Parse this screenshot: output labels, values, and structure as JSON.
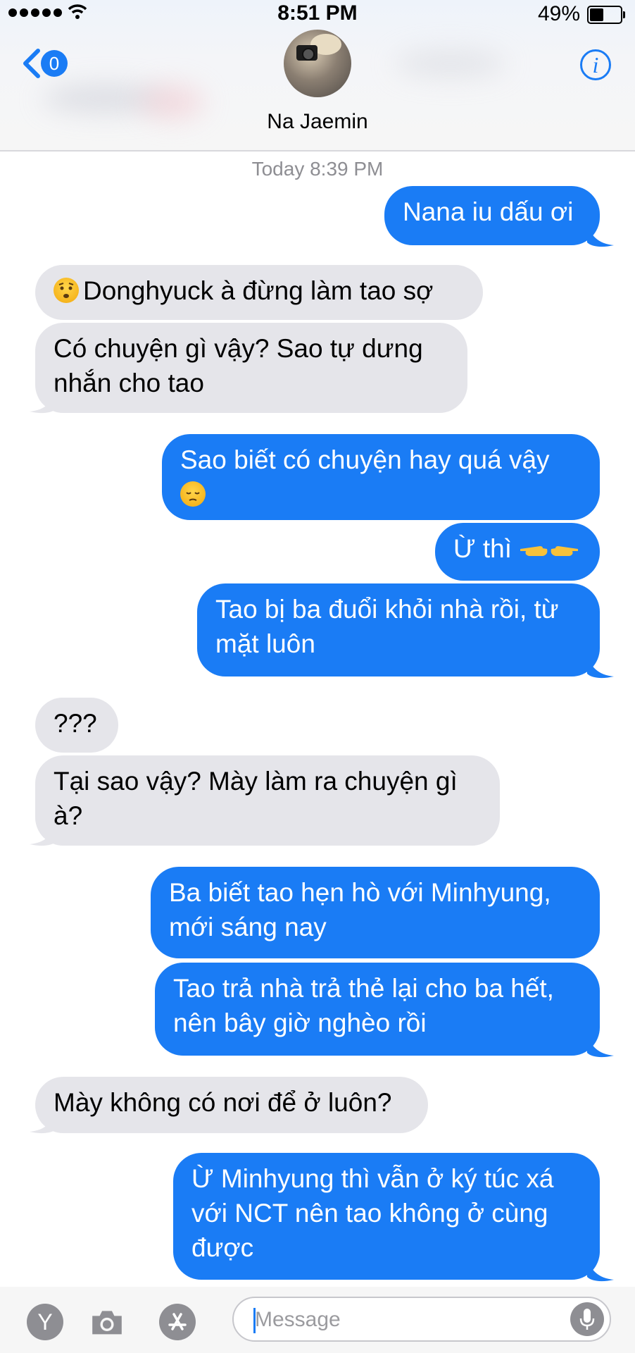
{
  "status_bar": {
    "time": "8:51 PM",
    "battery_percent": "49%",
    "battery_level": 0.49
  },
  "header": {
    "back_badge_count": "0",
    "contact_name": "Na Jaemin"
  },
  "thread": {
    "timestamp": "Today 8:39 PM",
    "messages": [
      {
        "side": "sent",
        "text": "Nana iu dấu ơi"
      },
      {
        "side": "received",
        "emoji": "worried-face-icon",
        "text": "Donghyuck à đừng làm tao sợ"
      },
      {
        "side": "received",
        "text": "Có chuyện gì vậy? Sao tự dưng nhắn cho tao"
      },
      {
        "side": "sent",
        "text": "Sao biết có chuyện hay quá vậy",
        "emoji": "pensive-face-icon"
      },
      {
        "side": "sent",
        "text": "Ừ thì",
        "emoji": "pointing-fingers-icon"
      },
      {
        "side": "sent",
        "text": "Tao bị ba đuổi khỏi nhà rồi, từ mặt luôn"
      },
      {
        "side": "received",
        "text": "???"
      },
      {
        "side": "received",
        "text": "Tại sao vậy? Mày làm ra chuyện gì à?"
      },
      {
        "side": "sent",
        "text": "Ba biết tao hẹn hò với Minhyung, mới sáng nay"
      },
      {
        "side": "sent",
        "text": "Tao trả nhà trả thẻ lại cho ba hết, nên bây giờ nghèo rồi"
      },
      {
        "side": "received",
        "text": "Mày không có nơi để ở luôn?"
      },
      {
        "side": "sent",
        "text": "Ừ Minhyung thì vẫn ở ký túc xá với NCT nên tao không ở cùng được"
      }
    ]
  },
  "input_bar": {
    "placeholder": "Message",
    "icons": [
      "memoji-icon",
      "camera-icon",
      "app-store-icon",
      "microphone-icon"
    ],
    "memoji_letter": "Y"
  },
  "colors": {
    "sent_bubble": "#1a7cf5",
    "received_bubble": "#e5e5ea",
    "accent": "#1a7cf5"
  }
}
